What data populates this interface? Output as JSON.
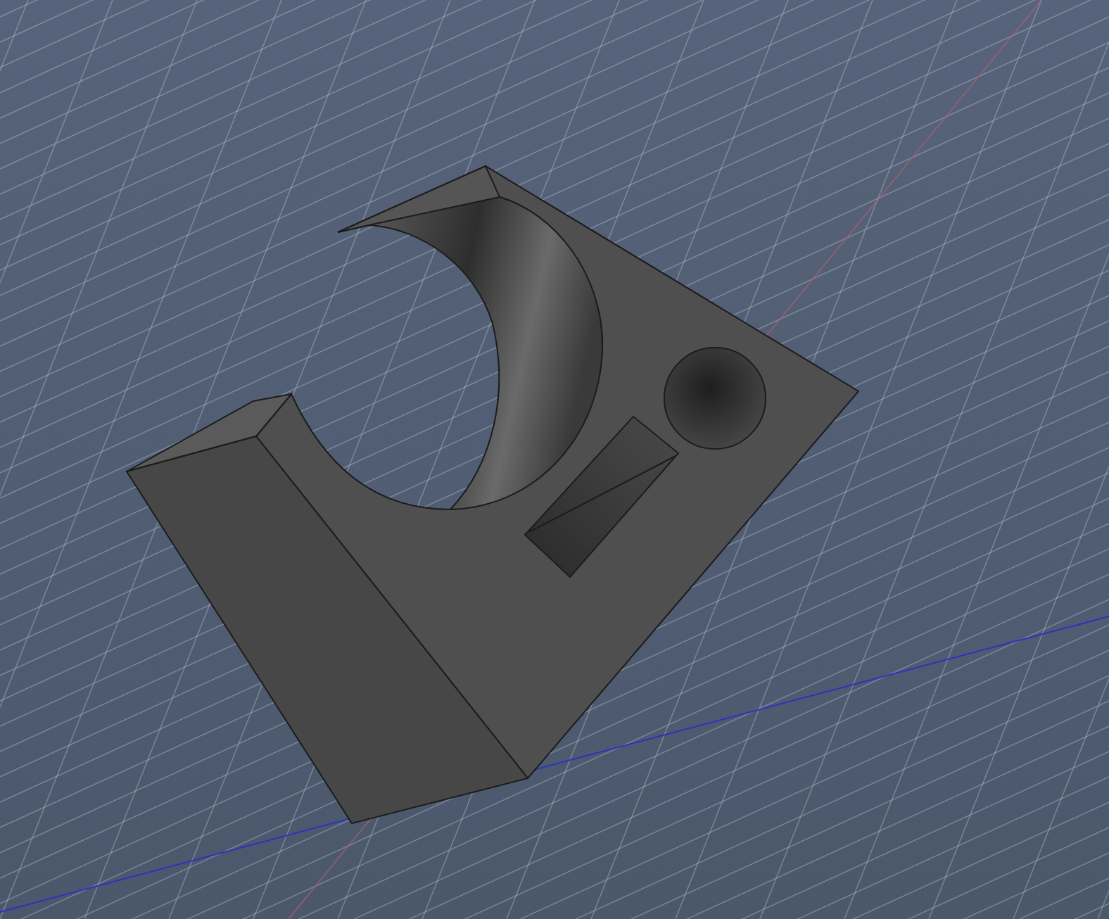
{
  "viewport": {
    "kind": "model"
  }
}
